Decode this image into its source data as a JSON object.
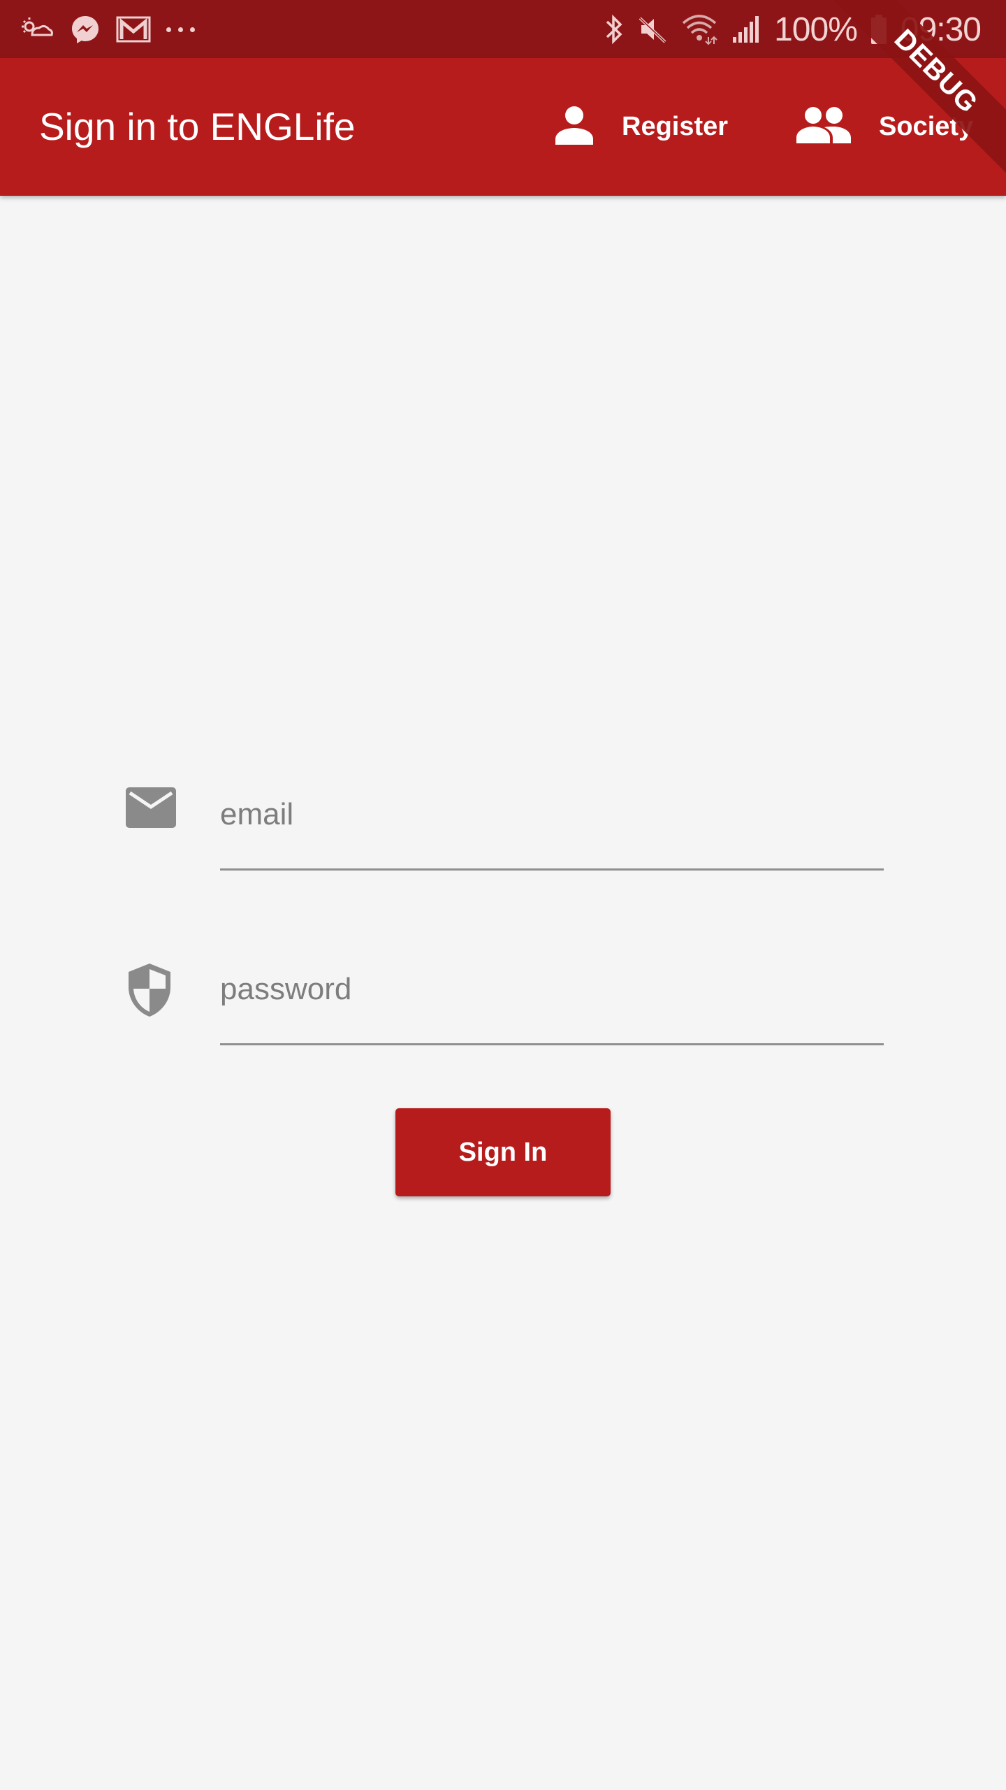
{
  "status_bar": {
    "left_icons": [
      "weather-icon",
      "messenger-icon",
      "gmail-icon",
      "more-dots-icon"
    ],
    "right_icons": [
      "bluetooth-icon",
      "mute-icon",
      "wifi-icon",
      "signal-icon",
      "battery-icon"
    ],
    "battery_percent": "100%",
    "time": "09:30"
  },
  "app_bar": {
    "title": "Sign in to ENGLife",
    "actions": [
      {
        "label": "Register",
        "icon": "person-icon"
      },
      {
        "label": "Society",
        "icon": "people-icon"
      }
    ]
  },
  "debug_banner": "DEBUG",
  "form": {
    "email": {
      "placeholder": "email",
      "value": "",
      "icon": "email-icon"
    },
    "password": {
      "placeholder": "password",
      "value": "",
      "icon": "shield-icon"
    },
    "submit_label": "Sign In"
  },
  "colors": {
    "primary": "#b71c1c",
    "status_bar": "#8e1517",
    "background": "#f5f5f5",
    "icon_grey": "#8a8a8a"
  }
}
